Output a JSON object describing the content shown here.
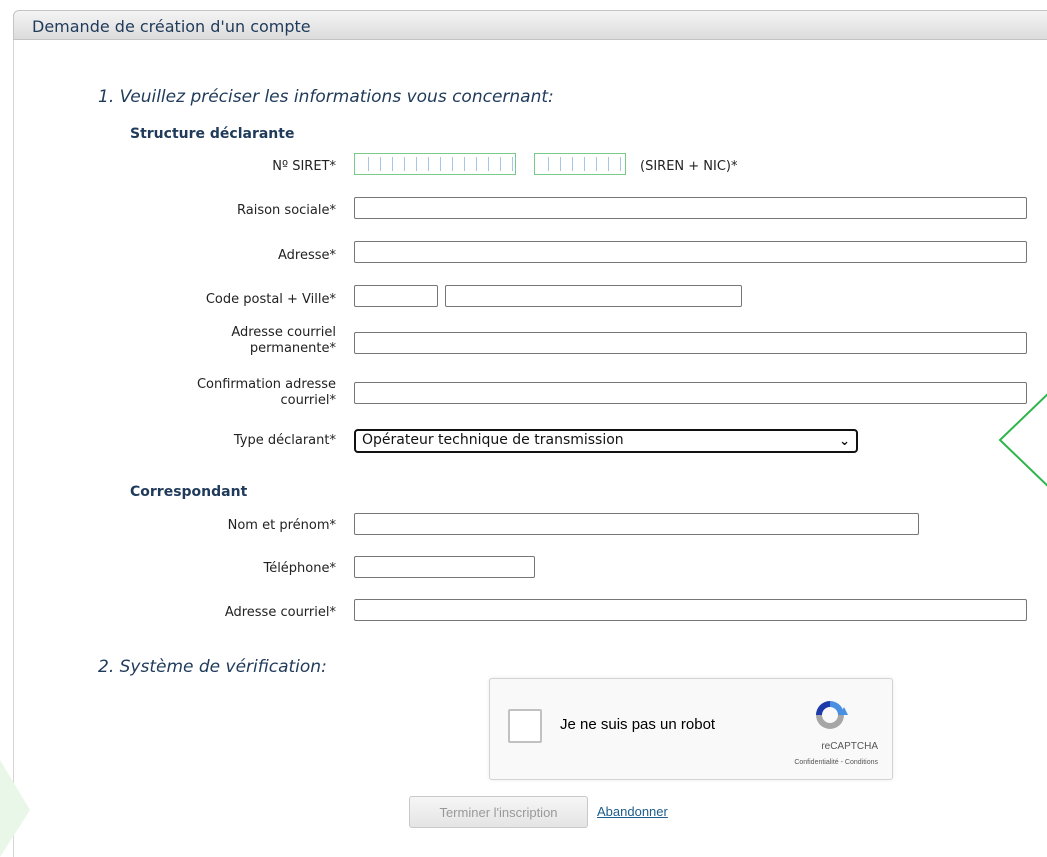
{
  "panel": {
    "title": "Demande de création d'un compte"
  },
  "section1": {
    "title": "1. Veuillez préciser les informations vous concernant:",
    "structure": {
      "title": "Structure déclarante",
      "siret_label": "Nº SIRET*",
      "siret_note": "(SIREN + NIC)*",
      "raison_sociale_label": "Raison sociale*",
      "adresse_label": "Adresse*",
      "code_postal_ville_label": "Code postal + Ville*",
      "courriel_permanent_label": "Adresse courriel permanente*",
      "confirmation_courriel_label": "Confirmation adresse courriel*",
      "type_declarant_label": "Type déclarant*",
      "type_declarant_value": "Opérateur technique de transmission"
    },
    "correspondant": {
      "title": "Correspondant",
      "nom_label": "Nom et prénom*",
      "telephone_label": "Téléphone*",
      "courriel_label": "Adresse courriel*"
    }
  },
  "section2": {
    "title": "2. Système de vérification:",
    "captcha": {
      "text": "Je ne suis pas un robot",
      "brand": "reCAPTCHA",
      "legal": "Confidentialité - Conditions"
    }
  },
  "actions": {
    "finish_label": "Terminer l'inscription",
    "abandon_label": "Abandonner"
  },
  "colors": {
    "header_text": "#1f3a5a",
    "siret_border": "#79c98a",
    "link": "#1d5e8c",
    "accent_green": "#2db54a"
  }
}
